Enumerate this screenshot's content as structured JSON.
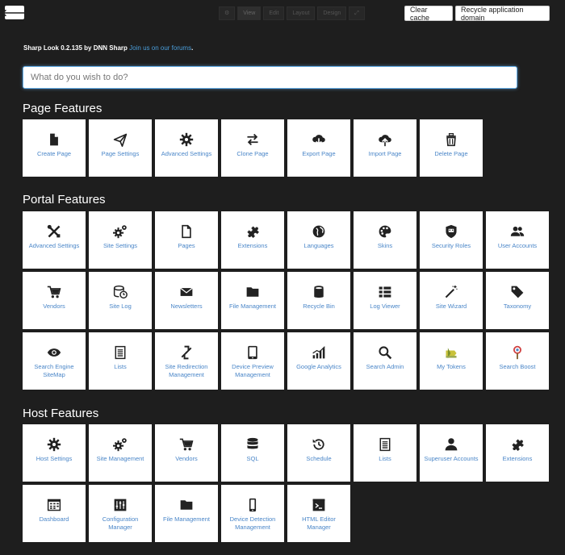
{
  "toolbar": {
    "back_icon": "arrow-left-icon",
    "modes": [
      "⚙",
      "View",
      "Edit",
      "Layout",
      "Design",
      "⤢"
    ],
    "clear_cache": "Clear cache",
    "recycle": "Recycle application domain"
  },
  "credit": {
    "text": "Sharp Look 0.2.135 by DNN Sharp",
    "link": "Join us on our forums",
    "period": "."
  },
  "search": {
    "placeholder": "What do you wish to do?"
  },
  "page_features": {
    "title": "Page Features",
    "items": [
      {
        "label": "Create Page",
        "icon": "file-icon"
      },
      {
        "label": "Page Settings",
        "icon": "paper-plane-icon"
      },
      {
        "label": "Advanced Settings",
        "icon": "gear-icon"
      },
      {
        "label": "Clone Page",
        "icon": "exchange-icon"
      },
      {
        "label": "Export Page",
        "icon": "cloud-download-icon"
      },
      {
        "label": "Import Page",
        "icon": "cloud-upload-icon"
      },
      {
        "label": "Delete Page",
        "icon": "trash-icon"
      }
    ]
  },
  "portal_features": {
    "title": "Portal Features",
    "items": [
      {
        "label": "Advanced Settings",
        "icon": "wrench-screwdriver-icon"
      },
      {
        "label": "Site Settings",
        "icon": "gears-icon"
      },
      {
        "label": "Pages",
        "icon": "page-icon"
      },
      {
        "label": "Extensions",
        "icon": "puzzle-icon"
      },
      {
        "label": "Languages",
        "icon": "globe-icon"
      },
      {
        "label": "Skins",
        "icon": "palette-icon"
      },
      {
        "label": "Security Roles",
        "icon": "shield-icon"
      },
      {
        "label": "User Accounts",
        "icon": "users-icon"
      },
      {
        "label": "Vendors",
        "icon": "cart-icon"
      },
      {
        "label": "Site Log",
        "icon": "database-clock-icon"
      },
      {
        "label": "Newsletters",
        "icon": "envelope-icon"
      },
      {
        "label": "File Management",
        "icon": "folder-icon"
      },
      {
        "label": "Recycle Bin",
        "icon": "bin-icon"
      },
      {
        "label": "Log Viewer",
        "icon": "list-icon"
      },
      {
        "label": "Site Wizard",
        "icon": "magic-wand-icon"
      },
      {
        "label": "Taxonomy",
        "icon": "tag-icon"
      },
      {
        "label": "Search Engine SiteMap",
        "icon": "eye-icon"
      },
      {
        "label": "Lists",
        "icon": "document-list-icon"
      },
      {
        "label": "Site Redirection Management",
        "icon": "redirect-arrows-icon"
      },
      {
        "label": "Device Preview Management",
        "icon": "tablet-icon"
      },
      {
        "label": "Google Analytics",
        "icon": "bar-chart-icon"
      },
      {
        "label": "Search Admin",
        "icon": "magnifier-icon"
      },
      {
        "label": "My Tokens",
        "icon": "token-icon"
      },
      {
        "label": "Search Boost",
        "icon": "search-boost-icon"
      }
    ]
  },
  "host_features": {
    "title": "Host Features",
    "items": [
      {
        "label": "Host Settings",
        "icon": "gear-icon"
      },
      {
        "label": "Site Management",
        "icon": "gears-icon"
      },
      {
        "label": "Vendors",
        "icon": "cart-icon"
      },
      {
        "label": "SQL",
        "icon": "database-icon"
      },
      {
        "label": "Schedule",
        "icon": "history-icon"
      },
      {
        "label": "Lists",
        "icon": "document-list-icon"
      },
      {
        "label": "Superuser Accounts",
        "icon": "user-icon"
      },
      {
        "label": "Extensions",
        "icon": "puzzle-icon"
      },
      {
        "label": "Dashboard",
        "icon": "dashboard-icon"
      },
      {
        "label": "Configuration Manager",
        "icon": "sliders-icon"
      },
      {
        "label": "File Management",
        "icon": "folder-icon"
      },
      {
        "label": "Device Detection Management",
        "icon": "mobile-icon"
      },
      {
        "label": "HTML Editor Manager",
        "icon": "terminal-icon"
      }
    ]
  },
  "colors": {
    "background": "#1e1e1e",
    "tile": "#ffffff",
    "tile_label": "#4a86c8",
    "icon": "#222222",
    "link": "#4a9edb"
  }
}
